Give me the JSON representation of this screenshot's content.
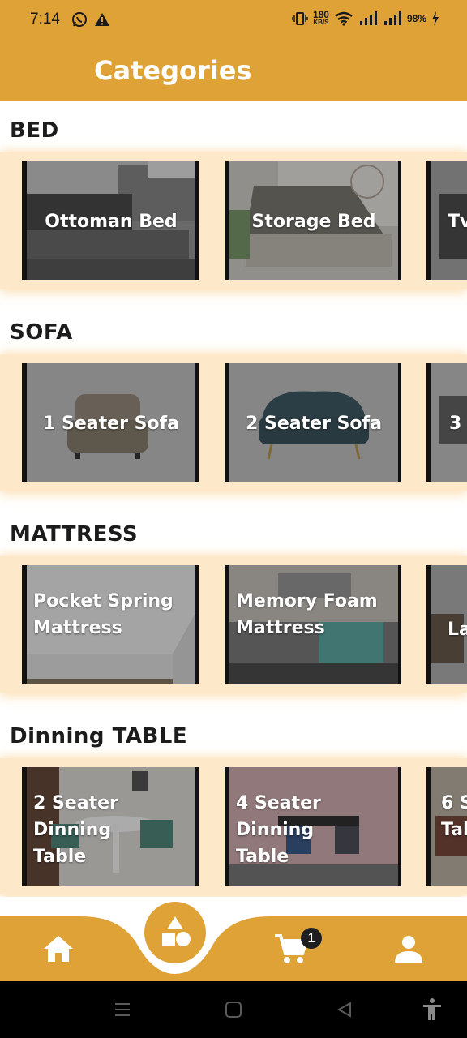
{
  "status_bar": {
    "time": "7:14",
    "data_speed": "180",
    "data_unit": "KB/S",
    "battery": "98%"
  },
  "header": {
    "title": "Categories"
  },
  "sections": [
    {
      "title": "BED",
      "cards": [
        {
          "label": "Ottoman Bed"
        },
        {
          "label": "Storage Bed"
        },
        {
          "label": "Tv"
        }
      ]
    },
    {
      "title": "SOFA",
      "cards": [
        {
          "label": "1 Seater Sofa"
        },
        {
          "label": "2 Seater Sofa"
        },
        {
          "label": "3"
        }
      ]
    },
    {
      "title": "MATTRESS",
      "cards": [
        {
          "label": "Pocket Spring\nMattress"
        },
        {
          "label": "Memory Foam\nMattress"
        },
        {
          "label": "La"
        }
      ]
    },
    {
      "title": "Dinning TABLE",
      "cards": [
        {
          "label": "2 Seater Dinning\nTable"
        },
        {
          "label": "4 Seater Dinning\nTable"
        },
        {
          "label": "6 S\nTab"
        }
      ]
    }
  ],
  "bottom_nav": {
    "cart_count": "1",
    "items": [
      {
        "icon": "home-icon"
      },
      {
        "icon": "categories-shapes-icon"
      },
      {
        "icon": "cart-icon"
      },
      {
        "icon": "profile-icon"
      }
    ]
  },
  "colors": {
    "accent": "#dea236",
    "strip": "#fde9c9"
  }
}
